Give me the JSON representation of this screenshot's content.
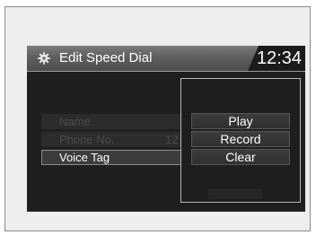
{
  "header": {
    "title": "Edit Speed Dial",
    "icon": "gear-icon",
    "clock": "12:34"
  },
  "entry_rows": [
    {
      "label": "Name",
      "value": "",
      "enabled": false
    },
    {
      "label": "Phone No.",
      "value": "12",
      "enabled": false
    },
    {
      "label": "Voice Tag",
      "value": "",
      "enabled": true
    }
  ],
  "voice_tag_menu": {
    "options": [
      "Play",
      "Record",
      "Clear"
    ]
  },
  "colors": {
    "screen_background": "#1f1f1f",
    "title_bar": "#5f5f5f",
    "text": "#ffffff",
    "disabled_text": "#4c4c4c"
  }
}
